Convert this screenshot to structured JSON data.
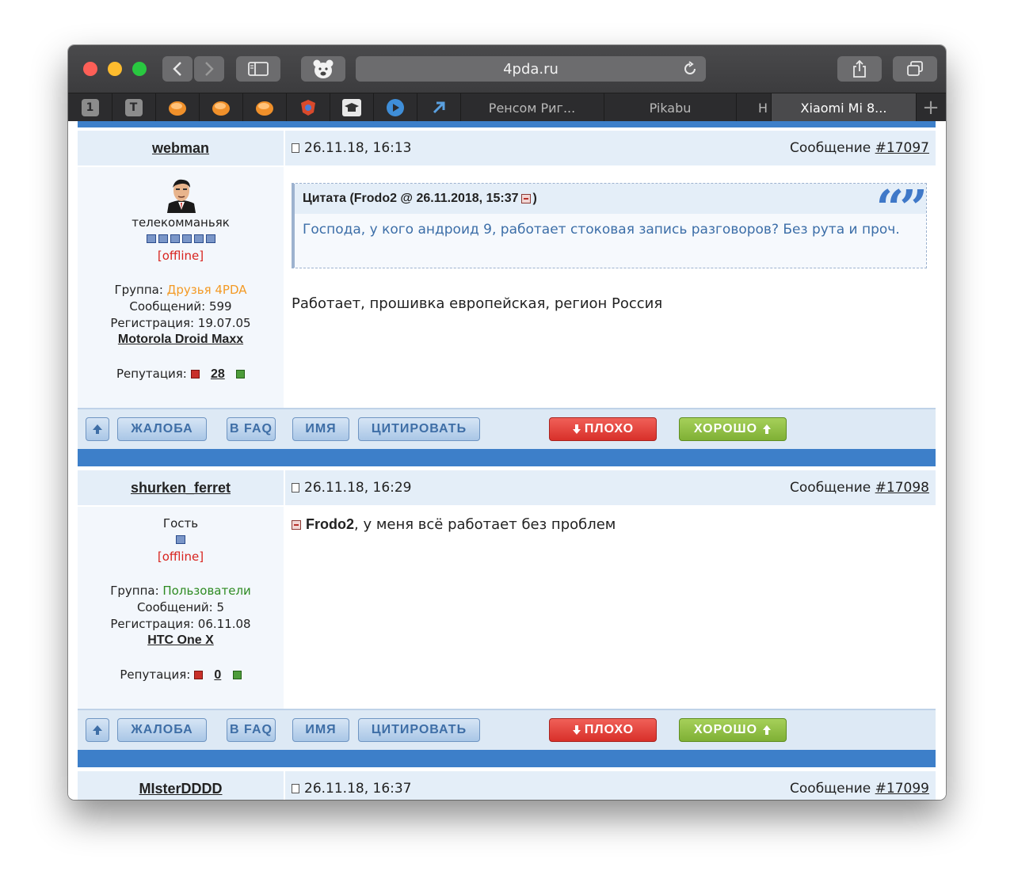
{
  "browser": {
    "address": "4pda.ru",
    "tabs": [
      {
        "label": "1",
        "type": "pinned"
      },
      {
        "label": "T",
        "type": "pinned"
      },
      {
        "label": "",
        "type": "pinned",
        "icon": "orange-favicon-icon"
      },
      {
        "label": "",
        "type": "pinned",
        "icon": "orange-favicon-icon"
      },
      {
        "label": "",
        "type": "pinned",
        "icon": "orange-favicon-icon"
      },
      {
        "label": "",
        "type": "pinned",
        "icon": "shield-favicon-icon"
      },
      {
        "label": "",
        "type": "pinned",
        "icon": "graduation-cap-icon"
      },
      {
        "label": "",
        "type": "pinned",
        "icon": "play-icon"
      },
      {
        "label": "",
        "type": "pinned",
        "icon": "arrow-up-right-icon"
      },
      {
        "label": "Ренсом Риг...",
        "type": "normal"
      },
      {
        "label": "Pikabu",
        "type": "normal"
      },
      {
        "label": "Н",
        "type": "normal"
      },
      {
        "label": "Xiaomi Mi 8...",
        "type": "active"
      }
    ]
  },
  "posts": [
    {
      "username": "webman",
      "date": "26.11.18, 16:13",
      "msg_prefix": "Сообщение ",
      "msg_num": "#17097",
      "title": "телекомманьяк",
      "pips": 6,
      "status": "[offline]",
      "group_label": "Группа: ",
      "group": "Друзья 4PDA",
      "messages": "Сообщений: 599",
      "registered": "Регистрация: 19.07.05",
      "device": "Motorola Droid Maxx",
      "rep_label": "Репутация: ",
      "rep": "28",
      "quote_head": "Цитата (Frodo2 @ 26.11.2018, 15:37 ",
      "quote_head_end": ")",
      "quote_text": "Господа, у кого андроид 9, работает стоковая запись разговоров? Без рута и проч.",
      "text": "Работает, прошивка европейская, регион Россия"
    },
    {
      "username": "shurken_ferret",
      "date": "26.11.18, 16:29",
      "msg_prefix": "Сообщение ",
      "msg_num": "#17098",
      "title": "Гость",
      "pips": 1,
      "status": "[offline]",
      "group_label": "Группа: ",
      "group": "Пользователи",
      "messages": "Сообщений: 5",
      "registered": "Регистрация: 06.11.08",
      "device": "HTC One X",
      "rep_label": "Репутация: ",
      "rep": "0",
      "mention": "Frodo2",
      "text": ", у меня всё работает без проблем"
    },
    {
      "username": "MIsterDDDD",
      "date": "26.11.18, 16:37",
      "msg_prefix": "Сообщение ",
      "msg_num": "#17099"
    }
  ],
  "actions": {
    "complaint": "ЖАЛОБА",
    "faq": "В FAQ",
    "name": "ИМЯ",
    "quote": "ЦИТИРОВАТЬ",
    "bad": "ПЛОХО",
    "good": "ХОРОШО"
  }
}
